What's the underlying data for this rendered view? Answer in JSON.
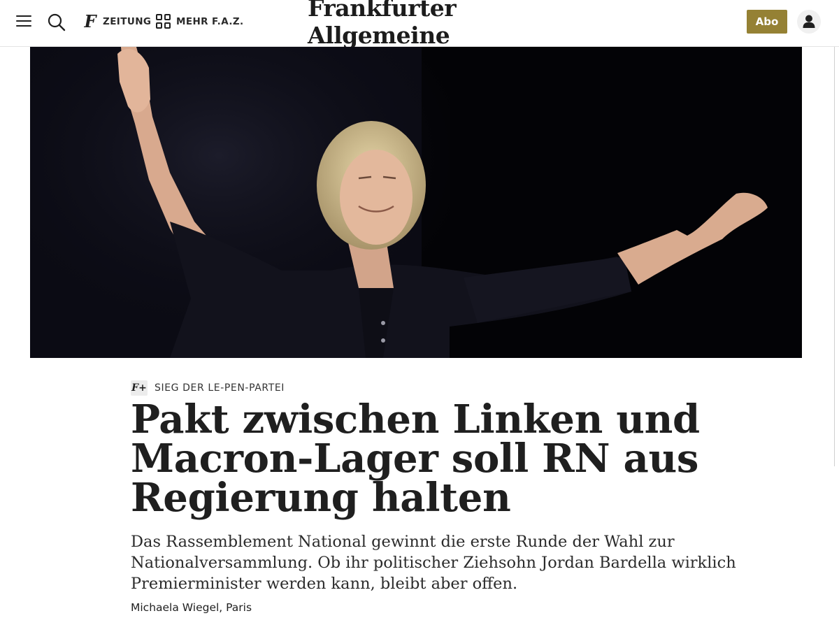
{
  "header": {
    "nav_zeitung_label": "ZEITUNG",
    "nav_mehr_label": "MEHR F.A.Z.",
    "logo_text": "Frankfurter Allgemeine",
    "abo_label": "Abo",
    "f_glyph": "F",
    "fplus_glyph": "F+"
  },
  "hero": {
    "alt": "Marine Le Pen mit ausgebreiteten Armen auf der Bühne"
  },
  "article": {
    "kicker": "SIEG DER LE-PEN-PARTEI",
    "headline": "Pakt zwischen Linken und Macron-Lager soll RN aus Regierung halten",
    "teaser": "Das Rassemblement National gewinnt die erste Runde der Wahl zur Nationalversammlung. Ob ihr politischer Ziehsohn Jordan Bardella wirklich Premierminister werden kann, bleibt aber offen.",
    "author": "Michaela Wiegel, Paris"
  },
  "colors": {
    "abo_background": "#958134",
    "text": "#1f1f1f",
    "hero_background": "#0b0b14"
  },
  "icons": [
    "menu-icon",
    "search-icon",
    "faz-f-icon",
    "grid-icon",
    "account-icon",
    "fplus-icon"
  ]
}
